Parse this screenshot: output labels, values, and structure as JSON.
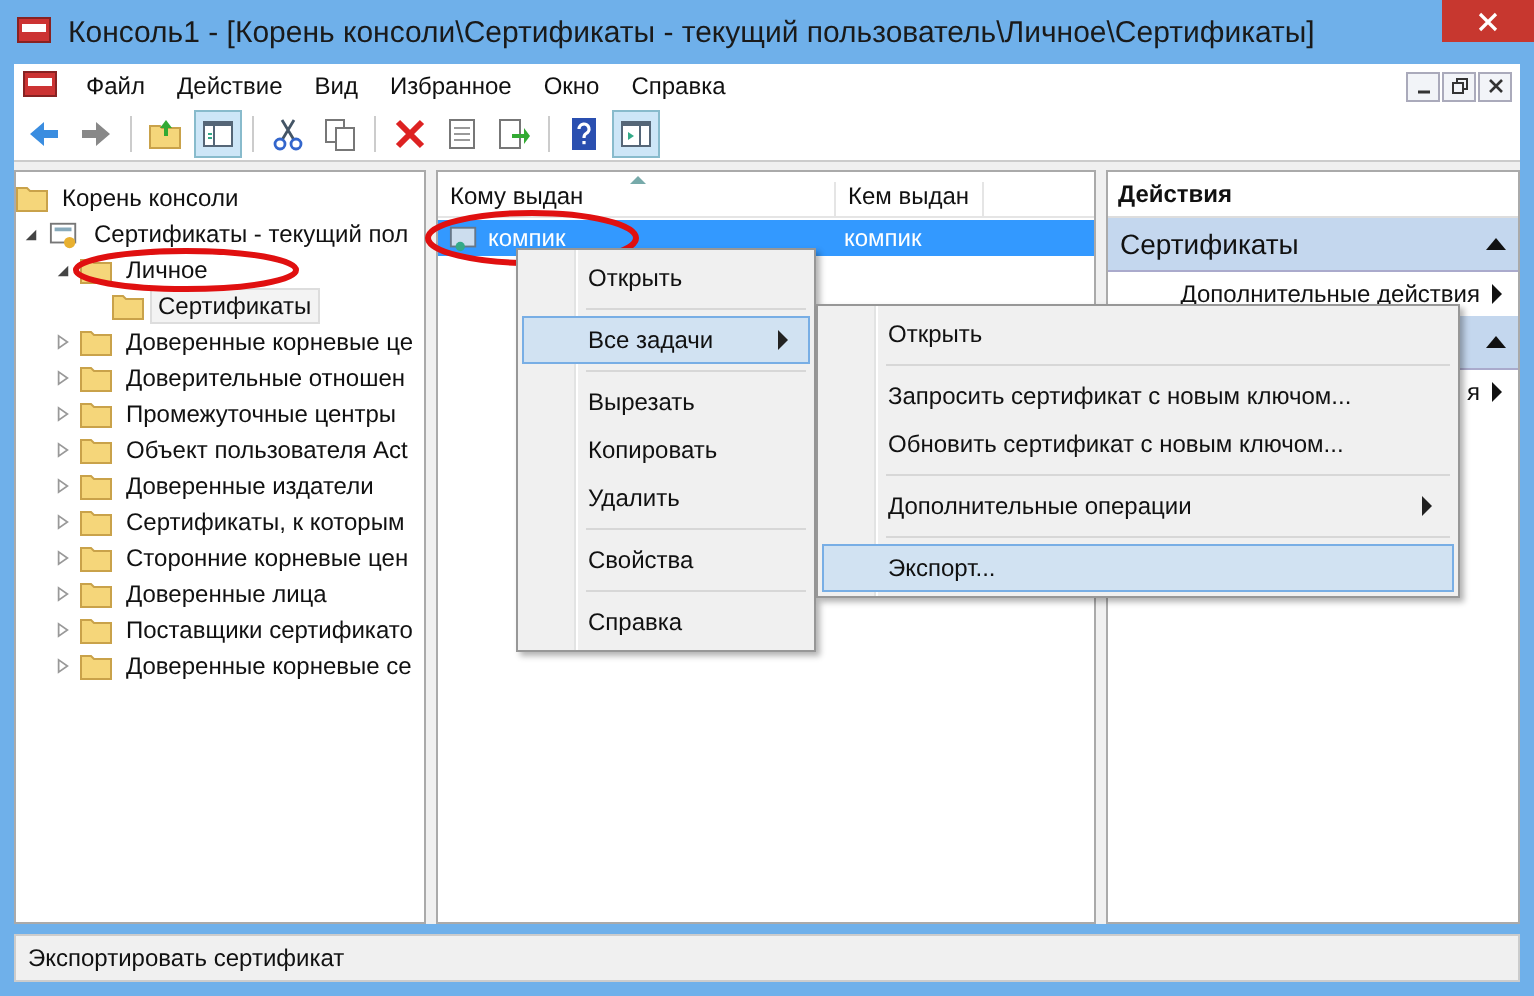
{
  "window": {
    "title": "Консоль1 - [Корень консоли\\Сертификаты - текущий пользователь\\Личное\\Сертификаты]"
  },
  "menu": [
    "Файл",
    "Действие",
    "Вид",
    "Избранное",
    "Окно",
    "Справка"
  ],
  "tree": {
    "label": "Корень консоли",
    "kind": "folder",
    "selected": false,
    "children": [
      {
        "label": "Сертификаты - текущий пол",
        "kind": "store",
        "expanded": true,
        "selected": false,
        "children": [
          {
            "label": "Личное",
            "kind": "folder",
            "expanded": true,
            "selected": false,
            "children": [
              {
                "label": "Сертификаты",
                "kind": "folder",
                "selected": true
              }
            ]
          },
          {
            "label": "Доверенные корневые це",
            "kind": "folder",
            "expanded": false,
            "selected": false
          },
          {
            "label": "Доверительные отношен",
            "kind": "folder",
            "expanded": false,
            "selected": false
          },
          {
            "label": "Промежуточные центры",
            "kind": "folder",
            "expanded": false,
            "selected": false
          },
          {
            "label": "Объект пользователя Act",
            "kind": "folder",
            "expanded": false,
            "selected": false
          },
          {
            "label": "Доверенные издатели",
            "kind": "folder",
            "expanded": false,
            "selected": false
          },
          {
            "label": "Сертификаты, к которым",
            "kind": "folder",
            "expanded": false,
            "selected": false
          },
          {
            "label": "Сторонние корневые цен",
            "kind": "folder",
            "expanded": false,
            "selected": false
          },
          {
            "label": "Доверенные лица",
            "kind": "folder",
            "expanded": false,
            "selected": false
          },
          {
            "label": "Поставщики сертификато",
            "kind": "folder",
            "expanded": false,
            "selected": false
          },
          {
            "label": "Доверенные корневые се",
            "kind": "folder",
            "expanded": false,
            "selected": false
          }
        ]
      }
    ]
  },
  "table": {
    "columns": [
      "Кому выдан",
      "Кем выдан"
    ],
    "rows": [
      {
        "cells": [
          "компик",
          "компик"
        ],
        "selected": true
      }
    ]
  },
  "actions": {
    "title": "Действия",
    "sections": [
      {
        "title": "Сертификаты",
        "expanded": true,
        "items": [
          "Дополнительные действия"
        ]
      },
      {
        "expanded": true,
        "items": [
          "я"
        ]
      }
    ]
  },
  "context_menu": {
    "groups": [
      [
        {
          "label": "Открыть",
          "submenu": false,
          "selected": false
        }
      ],
      [
        {
          "label": "Все задачи",
          "submenu": true,
          "selected": true
        }
      ],
      [
        {
          "label": "Вырезать",
          "submenu": false,
          "selected": false
        },
        {
          "label": "Копировать",
          "submenu": false,
          "selected": false
        },
        {
          "label": "Удалить",
          "submenu": false,
          "selected": false
        }
      ],
      [
        {
          "label": "Свойства",
          "submenu": false,
          "selected": false
        }
      ],
      [
        {
          "label": "Справка",
          "submenu": false,
          "selected": false
        }
      ]
    ]
  },
  "submenu": {
    "groups": [
      [
        {
          "label": "Открыть",
          "submenu": false,
          "selected": false
        }
      ],
      [
        {
          "label": "Запросить сертификат с новым ключом...",
          "submenu": false,
          "selected": false
        },
        {
          "label": "Обновить сертификат с новым ключом...",
          "submenu": false,
          "selected": false
        }
      ],
      [
        {
          "label": "Дополнительные операции",
          "submenu": true,
          "selected": false
        }
      ],
      [
        {
          "label": "Экспорт...",
          "submenu": false,
          "selected": true
        }
      ]
    ]
  },
  "status_bar": "Экспортировать сертификат"
}
